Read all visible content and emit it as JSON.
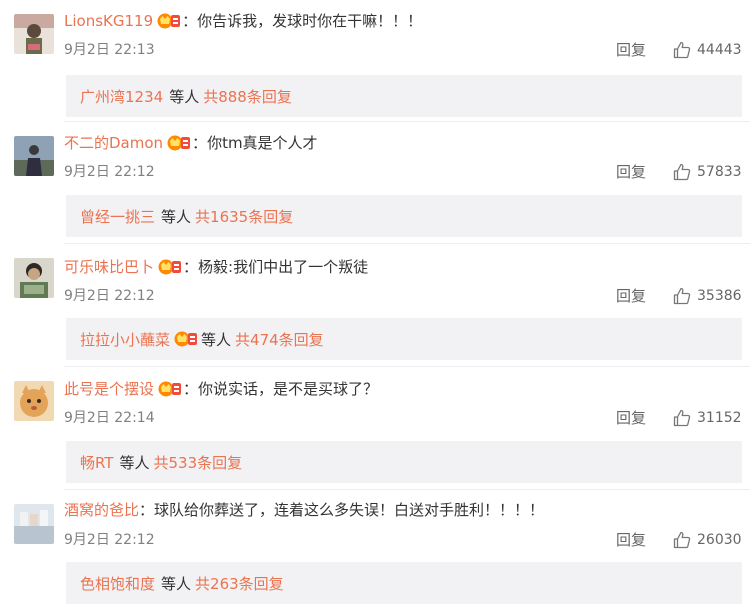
{
  "comments": [
    {
      "username": "LionsKG119",
      "text": "你告诉我，发球时你在干嘛！！！",
      "time": "9月2日 22:13",
      "likes": "44443",
      "reply_user": "广州湾1234",
      "reply_total": "共888条回复"
    },
    {
      "username": "不二的Damon",
      "text": "你tm真是个人才",
      "time": "9月2日 22:12",
      "likes": "57833",
      "reply_user": "曾经一挑三",
      "reply_total": "共1635条回复"
    },
    {
      "username": "可乐味比巴卜",
      "text": "杨毅:我们中出了一个叛徒",
      "time": "9月2日 22:12",
      "likes": "35386",
      "reply_user": "拉拉小小蘸菜",
      "reply_total": "共474条回复"
    },
    {
      "username": "此号是个摆设",
      "text": "你说实话，是不是买球了？",
      "time": "9月2日 22:14",
      "likes": "31152",
      "reply_user": "畅RT",
      "reply_total": "共533条回复"
    },
    {
      "username": "酒窝的爸比",
      "text": "球队给你葬送了，连着这么多失误！白送对手胜利！！！！",
      "time": "9月2日 22:12",
      "likes": "26030",
      "reply_user": "色相饱和度",
      "reply_total": "共263条回复"
    }
  ],
  "labels": {
    "reply_button": "回复",
    "colon": "：",
    "etc": "等人"
  },
  "icons": {
    "badge": "vip-crown-icon",
    "like": "thumbs-up-icon"
  },
  "colors": {
    "username": "#eb7350",
    "reply_bg": "#f2f2f5",
    "time": "#808080"
  }
}
